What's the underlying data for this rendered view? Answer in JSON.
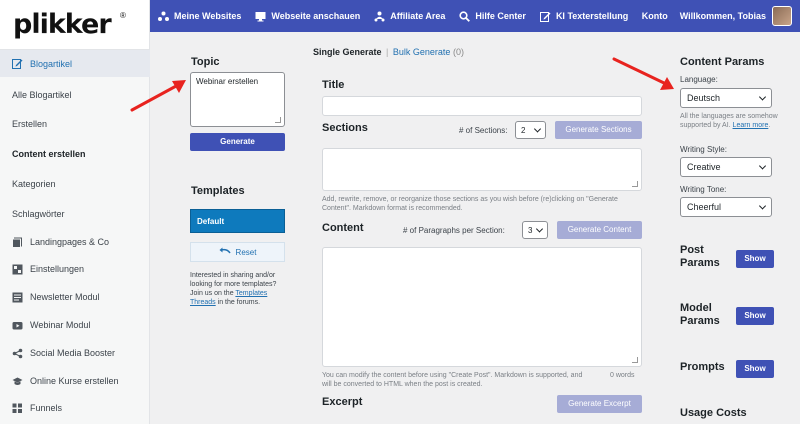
{
  "brand": {
    "logo": "plikker",
    "reg": "®"
  },
  "topbar": {
    "links": [
      "Meine Websites",
      "Webseite anschauen",
      "Affiliate Area",
      "Hilfe Center",
      "KI Texterstellung"
    ],
    "konto": "Konto",
    "welcome": "Willkommen, Tobias"
  },
  "sidebar": {
    "items": [
      "Blogartikel",
      "Alle Blogartikel",
      "Erstellen",
      "Content erstellen",
      "Kategorien",
      "Schlagwörter",
      "Landingpages & Co",
      "Einstellungen",
      "Newsletter Modul",
      "Webinar Modul",
      "Social Media Booster",
      "Online Kurse erstellen",
      "Funnels"
    ]
  },
  "left": {
    "topic_title": "Topic",
    "topic_value": "Webinar erstellen",
    "generate_label": "Generate",
    "templates_title": "Templates",
    "default_template": "Default",
    "reset_label": "Reset",
    "note_pre": "Interested in sharing and/or looking for more templates? Join us on the ",
    "note_link": "Templates Threads",
    "note_post": " in the forums."
  },
  "main": {
    "tab_active": "Single Generate",
    "tab_sep": "|",
    "tab_inactive": "Bulk Generate",
    "tab_count": "(0)",
    "title_label": "Title",
    "sections_label": "Sections",
    "sections_count_label": "# of Sections:",
    "sections_count_value": "2",
    "generate_sections": "Generate Sections",
    "sections_help": "Add, rewrite, remove, or reorganize those sections as you wish before (re)clicking on \"Generate Content\". Markdown format is recommended.",
    "content_label": "Content",
    "paragraphs_label": "# of Paragraphs per Section:",
    "paragraphs_value": "3",
    "generate_content": "Generate Content",
    "content_help": "You can modify the content before using \"Create Post\". Markdown is supported, and will be converted to HTML when the post is created.",
    "word_count": "0 words",
    "excerpt_label": "Excerpt",
    "generate_excerpt": "Generate Excerpt"
  },
  "right": {
    "content_params_title": "Content Params",
    "language_label": "Language:",
    "language_value": "Deutsch",
    "language_help_pre": "All the languages are somehow supported by AI. ",
    "language_help_link": "Learn more",
    "language_help_post": ".",
    "style_label": "Writing Style:",
    "style_value": "Creative",
    "tone_label": "Writing Tone:",
    "tone_value": "Cheerful",
    "post_params": "Post Params",
    "model_params": "Model Params",
    "prompts": "Prompts",
    "show_label": "Show",
    "usage_costs": "Usage Costs"
  },
  "colors": {
    "accent": "#3f51b5",
    "accent_disabled": "#a6acd6",
    "template_blue": "#0e7abd",
    "annotation_red": "#e8231f"
  }
}
